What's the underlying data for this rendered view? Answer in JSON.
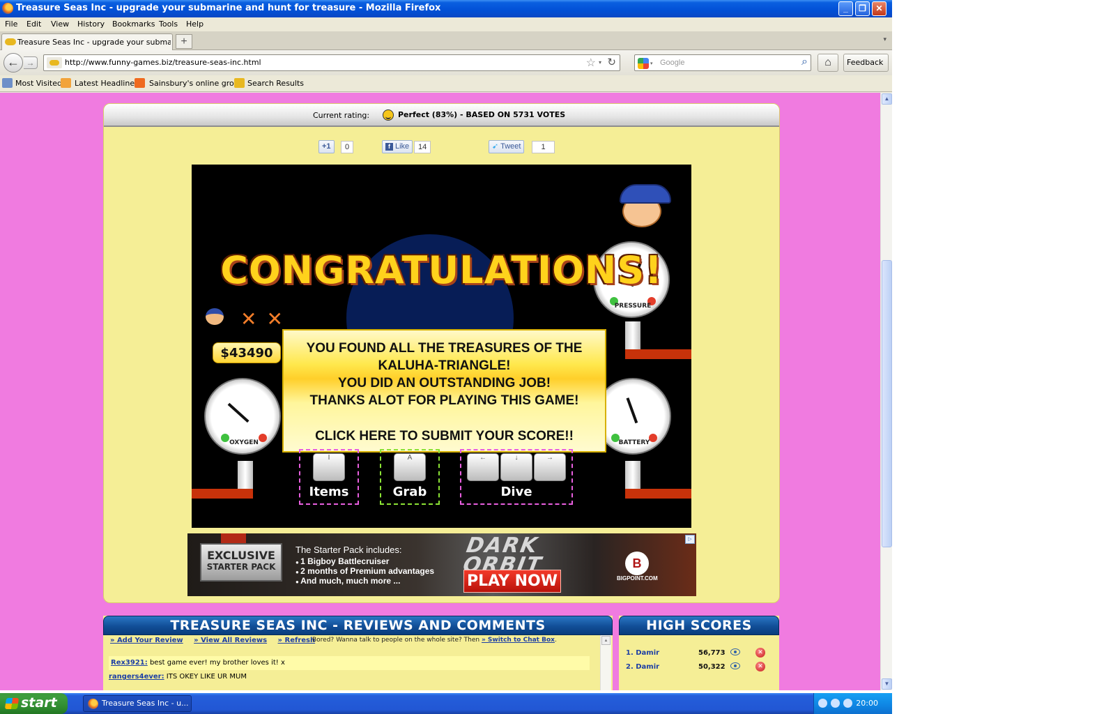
{
  "window": {
    "title": "Treasure Seas Inc - upgrade your submarine and hunt for treasure - Mozilla Firefox",
    "controls": {
      "minimize": "_",
      "maximize": "❐",
      "close": "✕"
    }
  },
  "menu": [
    "File",
    "Edit",
    "View",
    "History",
    "Bookmarks",
    "Tools",
    "Help"
  ],
  "tabs": {
    "active_label": "Treasure Seas Inc - upgrade your submarine...",
    "new_tab": "+",
    "list_arrow": "▾"
  },
  "nav": {
    "url": "http://www.funny-games.biz/treasure-seas-inc.html",
    "search_placeholder": "Google",
    "feedback_label": "Feedback ▾",
    "back_glyph": "←",
    "forward_glyph": "→",
    "reload_glyph": "↻",
    "star_glyph": "☆",
    "home_glyph": "⌂",
    "search_glyph": "⌕"
  },
  "bookmarks": [
    "Most Visited",
    "Latest Headlines",
    "Sainsbury's online gro...",
    "Search Results"
  ],
  "page": {
    "rating": {
      "label": "Current rating:",
      "value": "Perfect (83%) - BASED ON 5731 VOTES"
    },
    "share": {
      "gplus_label": "+1",
      "gplus_count": "0",
      "like_label": "Like",
      "like_count": "14",
      "tweet_label": "Tweet",
      "tweet_count": "1"
    },
    "game": {
      "congrats": "CONGRATULATIONS!",
      "message_lines": [
        "YOU FOUND ALL THE TREASURES OF THE",
        "KALUHA-TRIANGLE!",
        "YOU DID AN OUTSTANDING JOB!",
        "THANKS ALOT FOR PLAYING THIS GAME!"
      ],
      "submit_line": "CLICK HERE TO SUBMIT YOUR SCORE!!",
      "money": "$43490",
      "lives_marks": "✕✕",
      "gauges": {
        "oxygen": "OXYGEN",
        "pressure": "PRESSURE",
        "battery": "BATTERY"
      },
      "controls": {
        "items": {
          "label": "Items",
          "key": "I"
        },
        "grab": {
          "label": "Grab",
          "key": "A"
        },
        "dive": {
          "label": "Dive",
          "keys": [
            "←",
            "↓",
            "→"
          ]
        }
      }
    },
    "ad": {
      "badge_line1": "EXCLUSIVE",
      "badge_line2": "STARTER PACK",
      "heading": "The Starter Pack includes:",
      "items": [
        "1 Bigboy Battlecruiser",
        "2 months of Premium advantages",
        "And much, much more ..."
      ],
      "logo_line1": "DARK",
      "logo_line2": "ORBIT",
      "cta": "PLAY NOW",
      "brand": "BIGPOINT.COM",
      "brand_mark": "B",
      "adchoices": "▷"
    },
    "reviews": {
      "title": "TREASURE SEAS INC - REVIEWS AND COMMENTS",
      "links": [
        "» Add Your Review",
        "» View All Reviews",
        "» Refresh"
      ],
      "chat_note": "Bored? Wanna talk to people on the whole site? Then",
      "chat_link": "» Switch to Chat Box",
      "entries": [
        {
          "user": "Rex3921:",
          "text": " best game ever! my brother loves it! x"
        },
        {
          "user": "rangers4ever:",
          "text": " ITS OKEY LIKE UR MUM"
        }
      ]
    },
    "highscores": {
      "title": "HIGH SCORES",
      "rows": [
        {
          "name": "1. Damir",
          "score": "56,773"
        },
        {
          "name": "2. Damir",
          "score": "50,322"
        }
      ]
    }
  },
  "taskbar": {
    "start": "start",
    "item": "Treasure Seas Inc - u...",
    "clock": "20:00"
  },
  "colors": {
    "page_background": "#f07be0",
    "panel_background": "#f5ee96",
    "header_blue": "#114e97"
  }
}
